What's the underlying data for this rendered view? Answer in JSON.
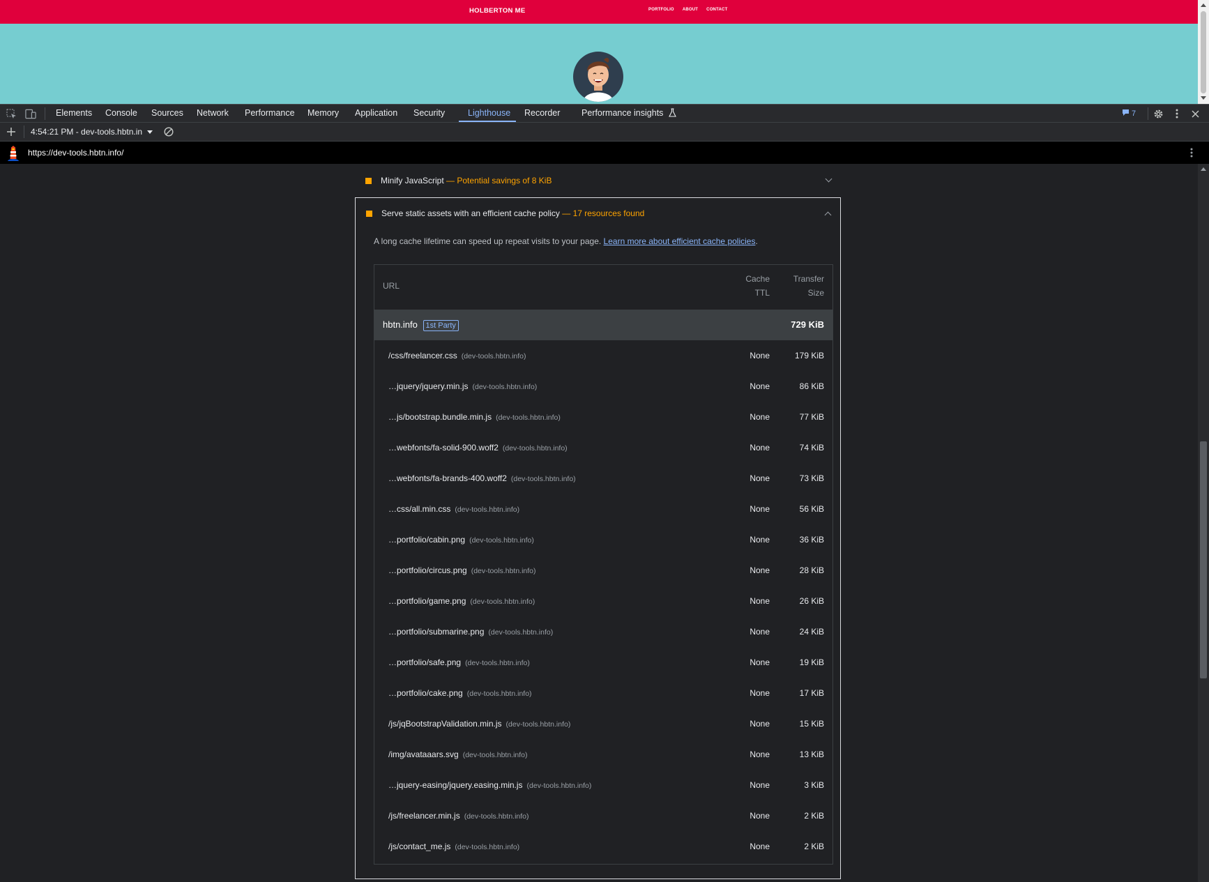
{
  "site": {
    "brand": "HOLBERTON ME",
    "nav": [
      "PORTFOLIO",
      "ABOUT",
      "CONTACT"
    ]
  },
  "devtools": {
    "tabs": [
      "Elements",
      "Console",
      "Sources",
      "Network",
      "Performance",
      "Memory",
      "Application",
      "Security",
      "Lighthouse",
      "Recorder",
      "Performance insights"
    ],
    "active_tab": "Lighthouse",
    "issues_count": "7"
  },
  "lighthouse": {
    "report_selector": "4:54:21 PM - dev-tools.hbtn.in",
    "url": "https://dev-tools.hbtn.info/"
  },
  "audits": {
    "minify_title": "Minify JavaScript",
    "minify_sub": "— Potential savings of 8 KiB",
    "cache_title": "Serve static assets with an efficient cache policy",
    "cache_sub": "— 17 resources found",
    "description": "A long cache lifetime can speed up repeat visits to your page.",
    "learn_more": "Learn more about efficient cache policies",
    "description_end": "."
  },
  "table": {
    "col_url": "URL",
    "col_ttl_1": "Cache",
    "col_ttl_2": "TTL",
    "col_size_1": "Transfer",
    "col_size_2": "Size",
    "group": {
      "name": "hbtn.info",
      "badge": "1st Party",
      "size": "729 KiB"
    },
    "rows": [
      {
        "url": "/css/freelancer.css",
        "host": "(dev-tools.hbtn.info)",
        "ttl": "None",
        "size": "179 KiB"
      },
      {
        "url": "…jquery/jquery.min.js",
        "host": "(dev-tools.hbtn.info)",
        "ttl": "None",
        "size": "86 KiB"
      },
      {
        "url": "…js/bootstrap.bundle.min.js",
        "host": "(dev-tools.hbtn.info)",
        "ttl": "None",
        "size": "77 KiB"
      },
      {
        "url": "…webfonts/fa-solid-900.woff2",
        "host": "(dev-tools.hbtn.info)",
        "ttl": "None",
        "size": "74 KiB"
      },
      {
        "url": "…webfonts/fa-brands-400.woff2",
        "host": "(dev-tools.hbtn.info)",
        "ttl": "None",
        "size": "73 KiB"
      },
      {
        "url": "…css/all.min.css",
        "host": "(dev-tools.hbtn.info)",
        "ttl": "None",
        "size": "56 KiB"
      },
      {
        "url": "…portfolio/cabin.png",
        "host": "(dev-tools.hbtn.info)",
        "ttl": "None",
        "size": "36 KiB"
      },
      {
        "url": "…portfolio/circus.png",
        "host": "(dev-tools.hbtn.info)",
        "ttl": "None",
        "size": "28 KiB"
      },
      {
        "url": "…portfolio/game.png",
        "host": "(dev-tools.hbtn.info)",
        "ttl": "None",
        "size": "26 KiB"
      },
      {
        "url": "…portfolio/submarine.png",
        "host": "(dev-tools.hbtn.info)",
        "ttl": "None",
        "size": "24 KiB"
      },
      {
        "url": "…portfolio/safe.png",
        "host": "(dev-tools.hbtn.info)",
        "ttl": "None",
        "size": "19 KiB"
      },
      {
        "url": "…portfolio/cake.png",
        "host": "(dev-tools.hbtn.info)",
        "ttl": "None",
        "size": "17 KiB"
      },
      {
        "url": "/js/jqBootstrapValidation.min.js",
        "host": "(dev-tools.hbtn.info)",
        "ttl": "None",
        "size": "15 KiB"
      },
      {
        "url": "/img/avataaars.svg",
        "host": "(dev-tools.hbtn.info)",
        "ttl": "None",
        "size": "13 KiB"
      },
      {
        "url": "…jquery-easing/jquery.easing.min.js",
        "host": "(dev-tools.hbtn.info)",
        "ttl": "None",
        "size": "3 KiB"
      },
      {
        "url": "/js/freelancer.min.js",
        "host": "(dev-tools.hbtn.info)",
        "ttl": "None",
        "size": "2 KiB"
      },
      {
        "url": "/js/contact_me.js",
        "host": "(dev-tools.hbtn.info)",
        "ttl": "None",
        "size": "2 KiB"
      }
    ]
  },
  "colors": {
    "site_nav": "#e0003c",
    "site_bg": "#76cdd0",
    "accent": "#8ab4f8",
    "warning": "#ffa400"
  },
  "icons": [
    "inspect-element-icon",
    "device-toolbar-icon",
    "issues-icon",
    "settings-icon",
    "more-options-icon",
    "close-icon",
    "add-icon",
    "clear-icon",
    "lighthouse-logo-icon",
    "chevron-down-icon",
    "chevron-up-icon"
  ]
}
